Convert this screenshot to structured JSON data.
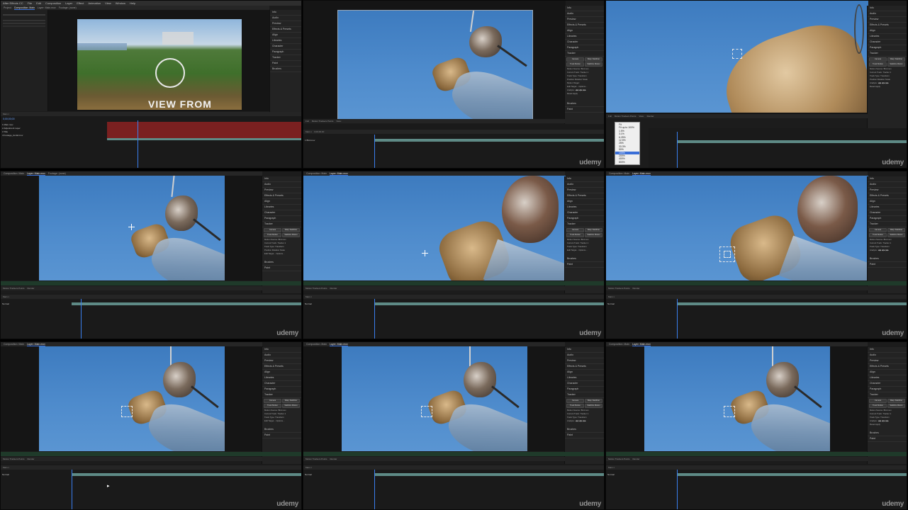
{
  "watermark": "udemy",
  "menus": [
    "After Effects CC",
    "File",
    "Edit",
    "Composition",
    "Layer",
    "Effect",
    "Animation",
    "View",
    "Window",
    "Help"
  ],
  "cell1": {
    "tabs": [
      "Project",
      "Composition: Main",
      "Layer: Main.mov",
      "Footage: (none)"
    ],
    "overlay_text": "VIEW FROM",
    "timecode": "0;00;00;00",
    "right_panel": [
      "Info",
      "Audio",
      "Preview",
      "Effects & Presets",
      "Align",
      "Libraries",
      "Character",
      "Paragraph",
      "Tracker",
      "Paint",
      "Brushes"
    ],
    "layers": [
      "1  Main.mov",
      "2  Adjustment Layer",
      "3  Title",
      "4  Footage_Aerial.mov"
    ]
  },
  "tracker_panel": {
    "title": "Tracker",
    "buttons": [
      "Camera",
      "Warp Stabilizer",
      "Track Motion",
      "Stabilize Motion"
    ],
    "rows": [
      "Motion Source: Bird.mov",
      "Current Track: Tracker 1",
      "Track Type: Transform",
      "Position  Rotation  Scale",
      "Motion Target:",
      "Edit Target...  Options...",
      "Analyze:  ◀◀  ◀  ▶  ▶▶",
      "Reset  Apply"
    ]
  },
  "right_panel": [
    "Info",
    "Audio",
    "Preview",
    "Effects & Presets",
    "Align",
    "Libraries",
    "Character",
    "Paragraph"
  ],
  "right_bottom": [
    "Brushes",
    "Paint"
  ],
  "viewer_status": [
    "Full",
    "Motion Trackers Points",
    "View:",
    "Render"
  ],
  "timeline_toolbar": [
    "Main ×",
    "0;00;00;00",
    "Source Name",
    "Mode",
    "T",
    "TrkMat"
  ],
  "layer_name": "1  Bird.mov",
  "layer_mode": "Normal",
  "timecode": "0;00;00;00",
  "zoom_menu": {
    "items": [
      "Fit",
      "Fit up to 100%",
      "1.5%",
      "3.1%",
      "6.25%",
      "12.5%",
      "25%",
      "33.3%",
      "50%",
      "100%",
      "200%",
      "400%",
      "800%"
    ],
    "selected": "100%"
  }
}
